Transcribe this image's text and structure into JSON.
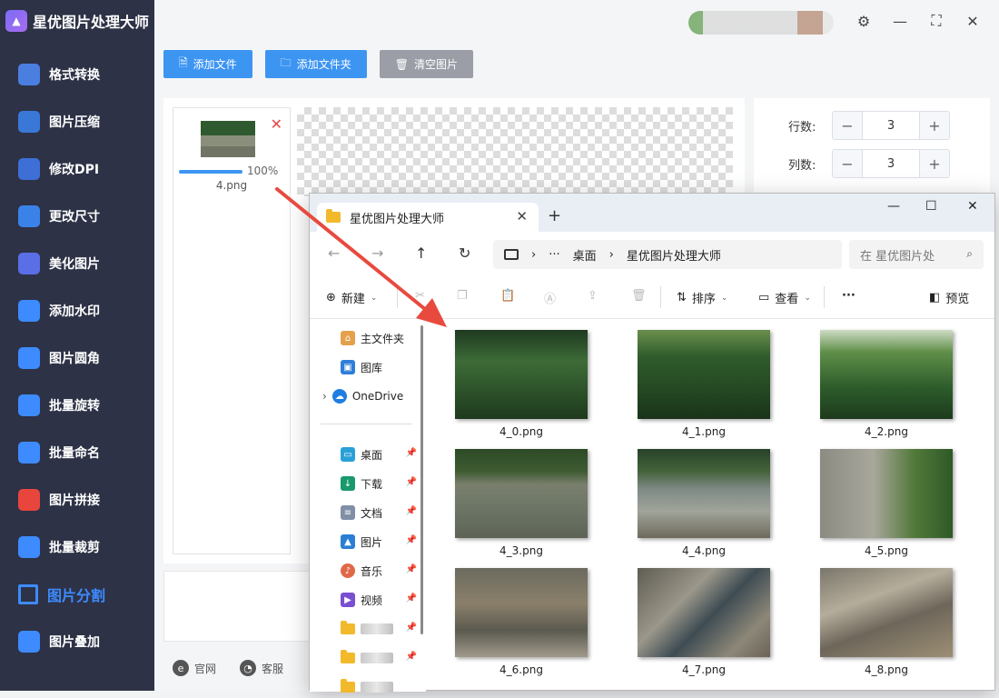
{
  "app": {
    "title": "星优图片处理大师",
    "logo_icon": "image-icon"
  },
  "sidebar": {
    "items": [
      {
        "label": "格式转换",
        "icon": "format-convert-icon",
        "color": "#4a7fe0"
      },
      {
        "label": "图片压缩",
        "icon": "compress-icon",
        "color": "#3a78d8"
      },
      {
        "label": "修改DPI",
        "icon": "dpi-icon",
        "color": "#3d6fd6"
      },
      {
        "label": "更改尺寸",
        "icon": "resize-icon",
        "color": "#3b82e8"
      },
      {
        "label": "美化图片",
        "icon": "beautify-icon",
        "color": "#5a6ee6"
      },
      {
        "label": "添加水印",
        "icon": "watermark-icon",
        "color": "#3d8bff"
      },
      {
        "label": "图片圆角",
        "icon": "round-corner-icon",
        "color": "#3d8bff"
      },
      {
        "label": "批量旋转",
        "icon": "rotate-icon",
        "color": "#3d8bff"
      },
      {
        "label": "批量命名",
        "icon": "rename-icon",
        "color": "#3d8bff"
      },
      {
        "label": "图片拼接",
        "icon": "stitch-icon",
        "color": "#e8453c"
      },
      {
        "label": "批量裁剪",
        "icon": "crop-icon",
        "color": "#3d8bff"
      },
      {
        "label": "图片分割",
        "icon": "split-icon",
        "color": "#3d8bff",
        "active": true
      },
      {
        "label": "图片叠加",
        "icon": "layers-icon",
        "color": "#3d8bff"
      }
    ]
  },
  "toolbar": {
    "add_file": "添加文件",
    "add_folder": "添加文件夹",
    "clear_images": "清空图片"
  },
  "file_card": {
    "name": "4.png",
    "progress_text": "100%",
    "progress": 1.0
  },
  "settings": {
    "rows_label": "行数:",
    "rows_value": "3",
    "cols_label": "列数:",
    "cols_value": "3"
  },
  "footer": {
    "website": "官网",
    "support": "客服"
  },
  "explorer": {
    "tab_title": "星优图片处理大师",
    "breadcrumb": [
      "桌面",
      "星优图片处理大师"
    ],
    "breadcrumb_more": "···",
    "search_placeholder": "在 星优图片处",
    "commands": {
      "new": "新建",
      "sort": "排序",
      "view": "查看",
      "more": "···",
      "preview": "预览"
    },
    "nav": {
      "home": "主文件夹",
      "gallery": "图库",
      "onedrive": "OneDrive",
      "desktop": "桌面",
      "downloads": "下载",
      "documents": "文档",
      "pictures": "图片",
      "music": "音乐",
      "videos": "视频"
    },
    "files": [
      {
        "name": "4_0.png",
        "style": "forest"
      },
      {
        "name": "4_1.png",
        "style": "forest2"
      },
      {
        "name": "4_2.png",
        "style": "forest3"
      },
      {
        "name": "4_3.png",
        "style": "river"
      },
      {
        "name": "4_4.png",
        "style": "river2"
      },
      {
        "name": "4_5.png",
        "style": "river3"
      },
      {
        "name": "4_6.png",
        "style": "rocks"
      },
      {
        "name": "4_7.png",
        "style": "rocks2"
      },
      {
        "name": "4_8.png",
        "style": "rocks3"
      }
    ]
  },
  "colors": {
    "accent": "#3d95f2",
    "sidebar_bg": "#2d3246",
    "arrow": "#e84a3f"
  }
}
